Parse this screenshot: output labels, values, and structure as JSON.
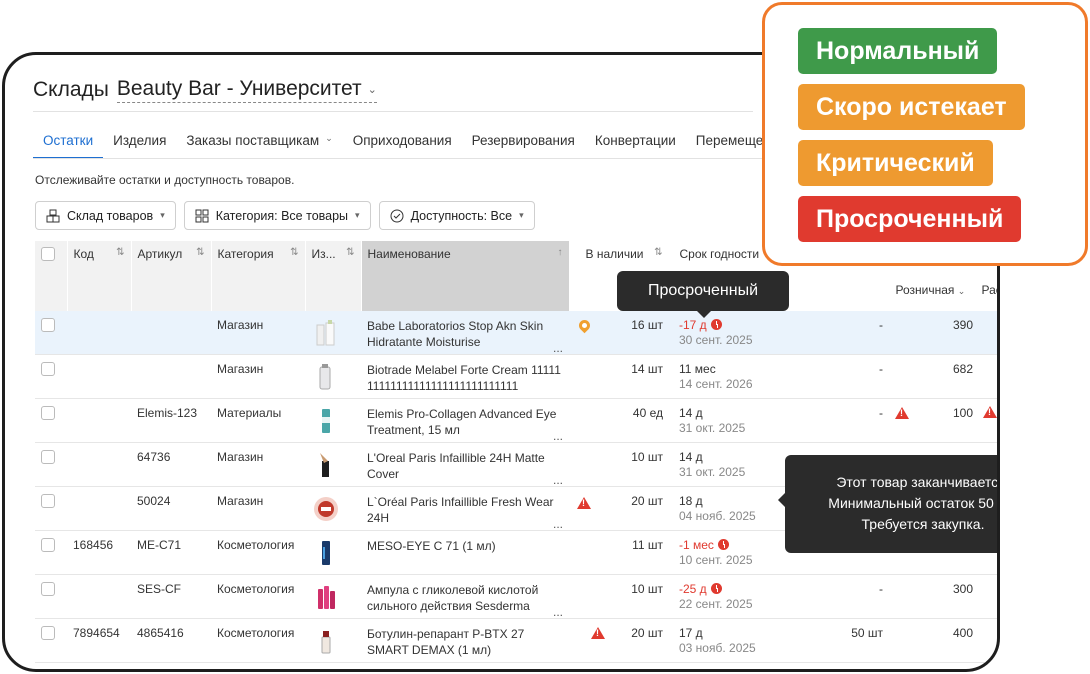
{
  "header": {
    "title_prefix": "Склады",
    "warehouse": "Beauty Bar - Университет"
  },
  "tabs": [
    "Остатки",
    "Изделия",
    "Заказы поставщикам",
    "Оприходования",
    "Резервирования",
    "Конвертации",
    "Перемещени"
  ],
  "description": "Отслеживайте остатки и доступность товаров.",
  "filters": [
    "Склад товаров",
    "Категория: Все товары",
    "Доступность: Все"
  ],
  "columns": {
    "code": "Код",
    "sku": "Артикул",
    "category": "Категория",
    "img": "Из...",
    "name": "Наименование",
    "stock": "В наличии",
    "expiry": "Срок годности",
    "retail": "Розничная",
    "more": "Рас"
  },
  "rows": [
    {
      "code": "",
      "sku": "",
      "category": "Магазин",
      "name": "Babe Laboratorios Stop Akn Skin Hidratante Moisturise",
      "stock": "16 шт",
      "exp1": "-17 д",
      "exp2": "30 сент. 2025",
      "mid": "-",
      "retail": "390"
    },
    {
      "code": "",
      "sku": "",
      "category": "Магазин",
      "name": "Biotrade Melabel Forte Cream 1111111111111111111111111111111",
      "stock": "14 шт",
      "exp1": "11 мес",
      "exp2": "14 сент. 2026",
      "mid": "-",
      "retail": "682"
    },
    {
      "code": "",
      "sku": "Elemis-123",
      "category": "Материалы",
      "name": "Elemis Pro-Collagen Advanced Eye Treatment, 15 мл",
      "stock": "40 ед",
      "exp1": "14 д",
      "exp2": "31 окт. 2025",
      "mid": "-",
      "retail": "100"
    },
    {
      "code": "",
      "sku": "64736",
      "category": "Магазин",
      "name": "L'Oreal Paris Infaillible 24H Matte Cover",
      "stock": "10 шт",
      "exp1": "14 д",
      "exp2": "31 окт. 2025",
      "mid": "",
      "retail": ""
    },
    {
      "code": "",
      "sku": "50024",
      "category": "Магазин",
      "name": "L`Oréal Paris Infaillible Fresh Wear 24H",
      "stock": "20 шт",
      "exp1": "18 д",
      "exp2": "04 нояб. 2025",
      "mid": "",
      "retail": ""
    },
    {
      "code": "168456",
      "sku": "ME-C71",
      "category": "Косметология",
      "name": "MESO-EYE C 71 (1 мл)",
      "stock": "11 шт",
      "exp1": "-1 мес",
      "exp2": "10 сент. 2025",
      "mid": "",
      "retail": ""
    },
    {
      "code": "",
      "sku": "SES-CF",
      "category": "Косметология",
      "name": "Ампула с гликолевой кислотой сильного действия Sesderma",
      "stock": "10 шт",
      "exp1": "-25 д",
      "exp2": "22 сент. 2025",
      "mid": "-",
      "retail": "300"
    },
    {
      "code": "7894654",
      "sku": "4865416",
      "category": "Косметология",
      "name": "Ботулин-репарант P-BTX 27 SMART DEMAX (1 мл)",
      "stock": "20 шт",
      "exp1": "17 д",
      "exp2": "03 нояб. 2025",
      "mid": "50 шт",
      "retail": "400"
    }
  ],
  "tooltips": {
    "status": "Просроченный",
    "stock_line1": "Этот товар заканчивается.",
    "stock_line2": "Минимальный остаток 50 шт.",
    "stock_line3": "Требуется закупка."
  },
  "legend": [
    {
      "label": "Нормальный",
      "color": "#3f9a4a"
    },
    {
      "label": "Скоро истекает",
      "color": "#ee9a30"
    },
    {
      "label": "Критический",
      "color": "#ee9a30"
    },
    {
      "label": "Просроченный",
      "color": "#e03a2f"
    }
  ]
}
